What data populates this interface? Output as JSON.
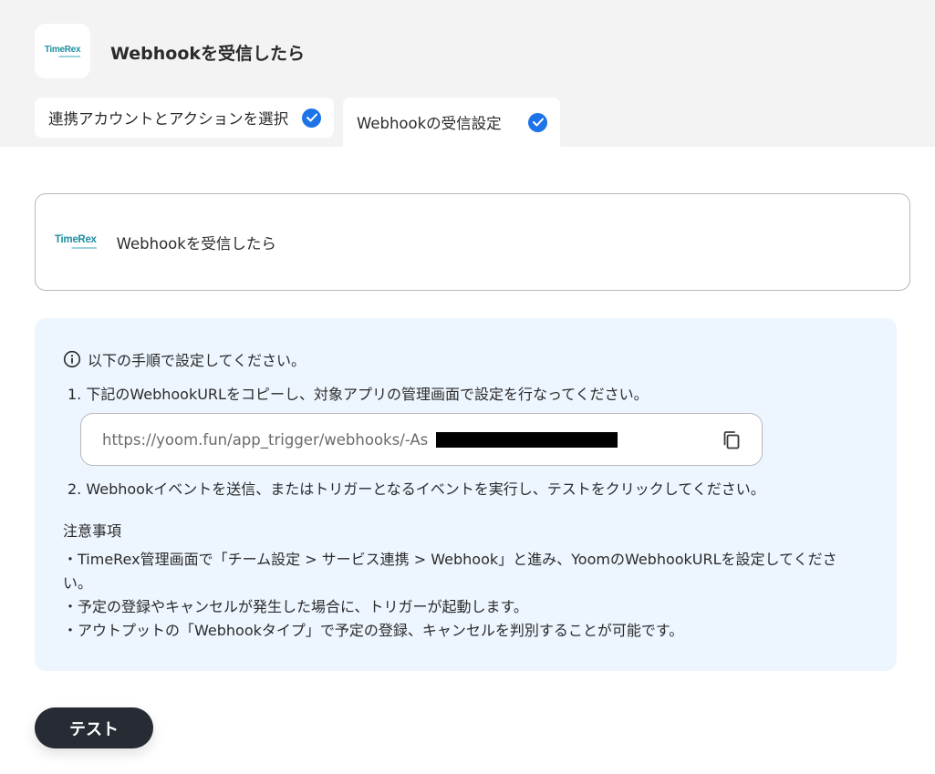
{
  "header": {
    "logo_text": "TimeRex",
    "title": "Webhookを受信したら"
  },
  "tabs": [
    {
      "label": "連携アカウントとアクションを選択",
      "completed": true
    },
    {
      "label": "Webhookの受信設定",
      "completed": true,
      "active": true
    }
  ],
  "action_card": {
    "logo_text": "TimeRex",
    "label": "Webhookを受信したら"
  },
  "info": {
    "heading": "以下の手順で設定してください。",
    "step1": "1. 下記のWebhookURLをコピーし、対象アプリの管理画面で設定を行なってください。",
    "url": "https://yoom.fun/app_trigger/webhooks/-As",
    "step2": "2. Webhookイベントを送信、またはトリガーとなるイベントを実行し、テストをクリックしてください。",
    "notes_title": "注意事項",
    "notes": [
      "・TimeRex管理画面で「チーム設定 > サービス連携 > Webhook」と進み、YoomのWebhookURLを設定してください。",
      "・予定の登録やキャンセルが発生した場合に、トリガーが起動します。",
      "・アウトプットの「Webhookタイプ」で予定の登録、キャンセルを判別することが可能です。"
    ]
  },
  "test_button_label": "テスト",
  "colors": {
    "accent": "#1d73e8",
    "info_bg": "#edf5fe",
    "button_bg": "#272b33",
    "logo": "#1f8fa0"
  }
}
